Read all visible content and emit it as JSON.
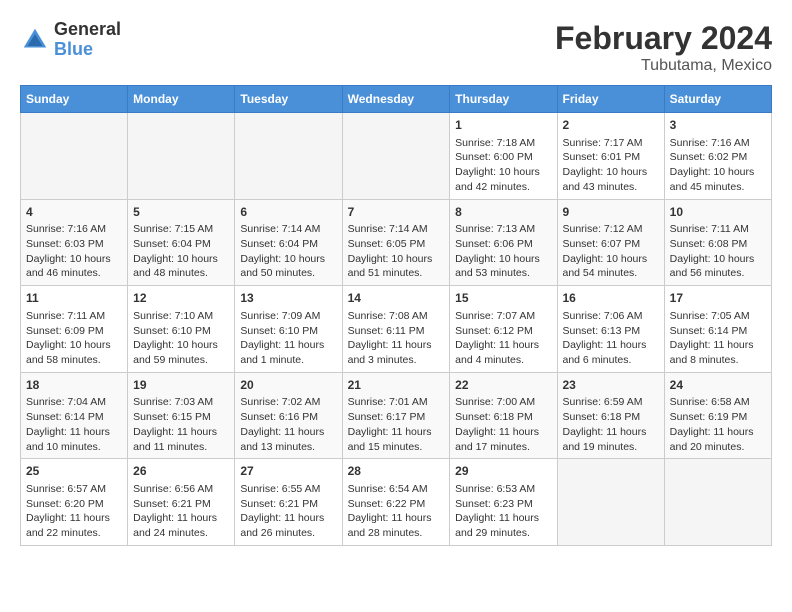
{
  "header": {
    "logo_general": "General",
    "logo_blue": "Blue",
    "main_title": "February 2024",
    "subtitle": "Tubutama, Mexico"
  },
  "days_of_week": [
    "Sunday",
    "Monday",
    "Tuesday",
    "Wednesday",
    "Thursday",
    "Friday",
    "Saturday"
  ],
  "weeks": [
    [
      {
        "day": "",
        "empty": true
      },
      {
        "day": "",
        "empty": true
      },
      {
        "day": "",
        "empty": true
      },
      {
        "day": "",
        "empty": true
      },
      {
        "day": "1",
        "sunrise": "7:18 AM",
        "sunset": "6:00 PM",
        "daylight": "10 hours and 42 minutes."
      },
      {
        "day": "2",
        "sunrise": "7:17 AM",
        "sunset": "6:01 PM",
        "daylight": "10 hours and 43 minutes."
      },
      {
        "day": "3",
        "sunrise": "7:16 AM",
        "sunset": "6:02 PM",
        "daylight": "10 hours and 45 minutes."
      }
    ],
    [
      {
        "day": "4",
        "sunrise": "7:16 AM",
        "sunset": "6:03 PM",
        "daylight": "10 hours and 46 minutes."
      },
      {
        "day": "5",
        "sunrise": "7:15 AM",
        "sunset": "6:04 PM",
        "daylight": "10 hours and 48 minutes."
      },
      {
        "day": "6",
        "sunrise": "7:14 AM",
        "sunset": "6:04 PM",
        "daylight": "10 hours and 50 minutes."
      },
      {
        "day": "7",
        "sunrise": "7:14 AM",
        "sunset": "6:05 PM",
        "daylight": "10 hours and 51 minutes."
      },
      {
        "day": "8",
        "sunrise": "7:13 AM",
        "sunset": "6:06 PM",
        "daylight": "10 hours and 53 minutes."
      },
      {
        "day": "9",
        "sunrise": "7:12 AM",
        "sunset": "6:07 PM",
        "daylight": "10 hours and 54 minutes."
      },
      {
        "day": "10",
        "sunrise": "7:11 AM",
        "sunset": "6:08 PM",
        "daylight": "10 hours and 56 minutes."
      }
    ],
    [
      {
        "day": "11",
        "sunrise": "7:11 AM",
        "sunset": "6:09 PM",
        "daylight": "10 hours and 58 minutes."
      },
      {
        "day": "12",
        "sunrise": "7:10 AM",
        "sunset": "6:10 PM",
        "daylight": "10 hours and 59 minutes."
      },
      {
        "day": "13",
        "sunrise": "7:09 AM",
        "sunset": "6:10 PM",
        "daylight": "11 hours and 1 minute."
      },
      {
        "day": "14",
        "sunrise": "7:08 AM",
        "sunset": "6:11 PM",
        "daylight": "11 hours and 3 minutes."
      },
      {
        "day": "15",
        "sunrise": "7:07 AM",
        "sunset": "6:12 PM",
        "daylight": "11 hours and 4 minutes."
      },
      {
        "day": "16",
        "sunrise": "7:06 AM",
        "sunset": "6:13 PM",
        "daylight": "11 hours and 6 minutes."
      },
      {
        "day": "17",
        "sunrise": "7:05 AM",
        "sunset": "6:14 PM",
        "daylight": "11 hours and 8 minutes."
      }
    ],
    [
      {
        "day": "18",
        "sunrise": "7:04 AM",
        "sunset": "6:14 PM",
        "daylight": "11 hours and 10 minutes."
      },
      {
        "day": "19",
        "sunrise": "7:03 AM",
        "sunset": "6:15 PM",
        "daylight": "11 hours and 11 minutes."
      },
      {
        "day": "20",
        "sunrise": "7:02 AM",
        "sunset": "6:16 PM",
        "daylight": "11 hours and 13 minutes."
      },
      {
        "day": "21",
        "sunrise": "7:01 AM",
        "sunset": "6:17 PM",
        "daylight": "11 hours and 15 minutes."
      },
      {
        "day": "22",
        "sunrise": "7:00 AM",
        "sunset": "6:18 PM",
        "daylight": "11 hours and 17 minutes."
      },
      {
        "day": "23",
        "sunrise": "6:59 AM",
        "sunset": "6:18 PM",
        "daylight": "11 hours and 19 minutes."
      },
      {
        "day": "24",
        "sunrise": "6:58 AM",
        "sunset": "6:19 PM",
        "daylight": "11 hours and 20 minutes."
      }
    ],
    [
      {
        "day": "25",
        "sunrise": "6:57 AM",
        "sunset": "6:20 PM",
        "daylight": "11 hours and 22 minutes."
      },
      {
        "day": "26",
        "sunrise": "6:56 AM",
        "sunset": "6:21 PM",
        "daylight": "11 hours and 24 minutes."
      },
      {
        "day": "27",
        "sunrise": "6:55 AM",
        "sunset": "6:21 PM",
        "daylight": "11 hours and 26 minutes."
      },
      {
        "day": "28",
        "sunrise": "6:54 AM",
        "sunset": "6:22 PM",
        "daylight": "11 hours and 28 minutes."
      },
      {
        "day": "29",
        "sunrise": "6:53 AM",
        "sunset": "6:23 PM",
        "daylight": "11 hours and 29 minutes."
      },
      {
        "day": "",
        "empty": true
      },
      {
        "day": "",
        "empty": true
      }
    ]
  ]
}
